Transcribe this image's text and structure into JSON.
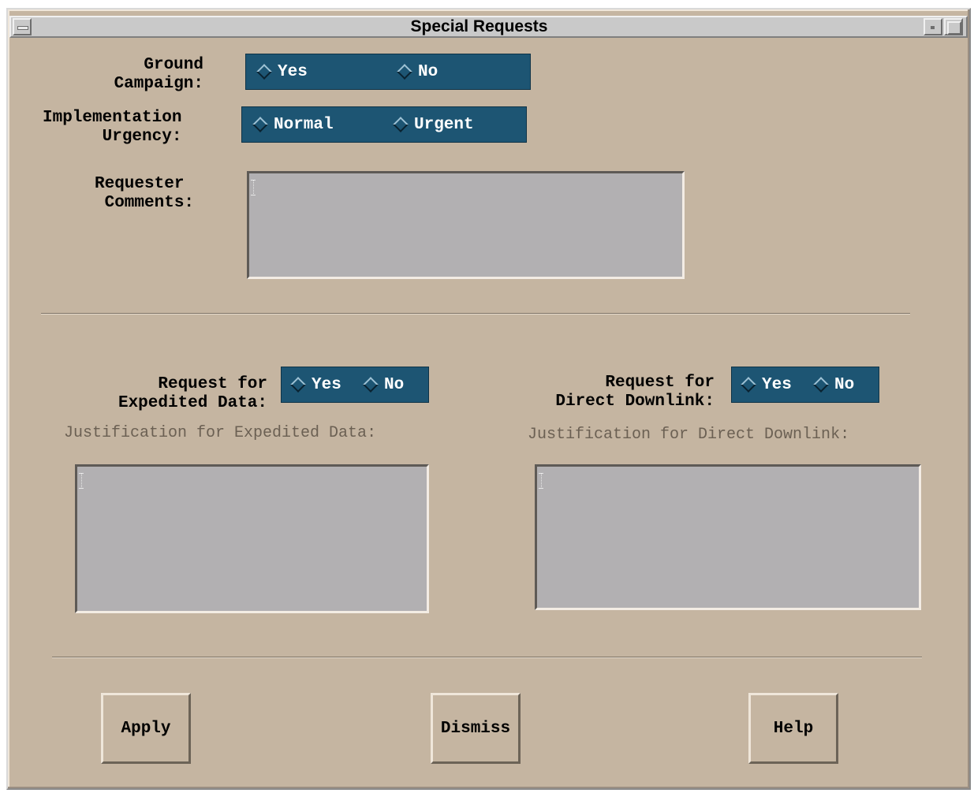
{
  "window": {
    "title": "Special Requests"
  },
  "ground_campaign": {
    "label": "Ground\nCampaign:",
    "options": [
      "Yes",
      "No"
    ]
  },
  "implementation_urgency": {
    "label": "Implementation\n      Urgency:",
    "options": [
      "Normal",
      "Urgent"
    ]
  },
  "requester_comments": {
    "label": "Requester\n Comments:",
    "value": ""
  },
  "expedited_data": {
    "label": "Request for\nExpedited Data:",
    "options": [
      "Yes",
      "No"
    ],
    "justification_label": "Justification for Expedited Data:",
    "justification_value": ""
  },
  "direct_downlink": {
    "label": "Request for\nDirect Downlink:",
    "options": [
      "Yes",
      "No"
    ],
    "justification_label": "Justification for Direct Downlink:",
    "justification_value": ""
  },
  "buttons": {
    "apply": "Apply",
    "dismiss": "Dismiss",
    "help": "Help"
  },
  "colors": {
    "background": "#c5b5a1",
    "radio_box": "#1d5573",
    "text_field": "#b2b0b2"
  },
  "icons": {
    "window_menu": "window-menu-icon",
    "minimize": "minimize-icon",
    "maximize": "maximize-icon",
    "radio": "diamond-radio-icon",
    "text_cursor": "text-cursor-icon"
  }
}
